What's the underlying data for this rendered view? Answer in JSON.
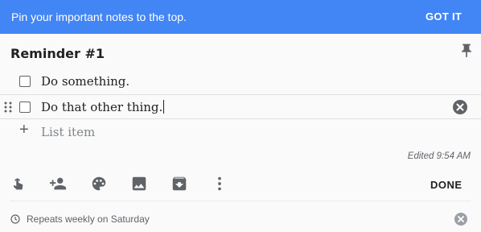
{
  "banner": {
    "message": "Pin your important notes to the top.",
    "action": "GOT IT",
    "color": "#4285f4"
  },
  "note": {
    "title": "Reminder #1",
    "items": [
      {
        "text": "Do something.",
        "checked": false
      },
      {
        "text": "Do that other thing.",
        "checked": false
      }
    ],
    "add_placeholder": "List item",
    "edited": "Edited 9:54 AM"
  },
  "toolbar": {
    "icons": [
      "reminder-hand-icon",
      "collaborator-icon",
      "palette-icon",
      "image-icon",
      "archive-icon",
      "more-icon"
    ],
    "done_label": "DONE"
  },
  "reminder": {
    "text": "Repeats weekly on Saturday"
  }
}
